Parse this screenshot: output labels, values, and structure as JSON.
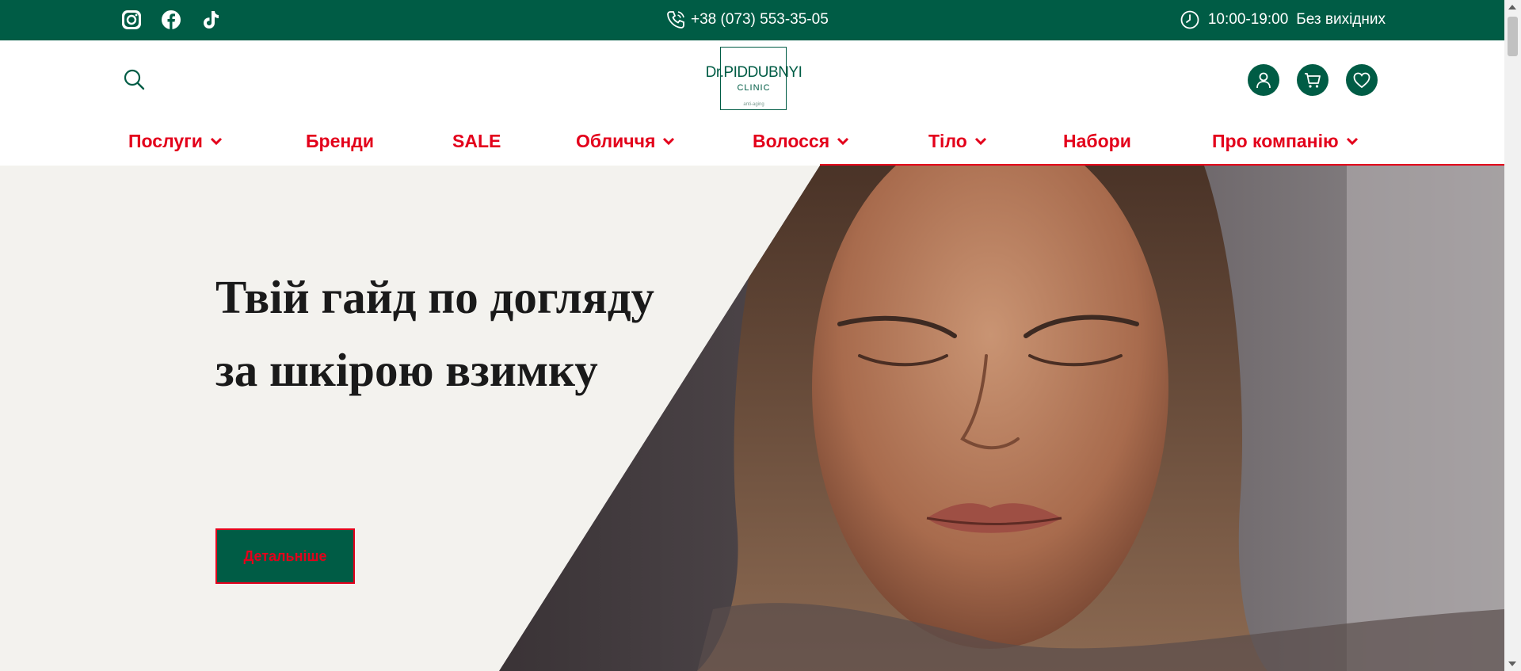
{
  "topbar": {
    "social_icons": [
      "instagram-icon",
      "facebook-icon",
      "tiktok-icon"
    ],
    "phone": "+38 (073) 553-35-05",
    "hours": "10:00-19:00",
    "days": "Без вихідних"
  },
  "header": {
    "logo": {
      "name": "Dr.PIDDUBNYI",
      "sub": "CLINIC",
      "tagline": "anti-aging"
    },
    "icons": [
      "search-icon",
      "user-icon",
      "cart-icon",
      "heart-icon"
    ]
  },
  "nav": {
    "items": [
      {
        "label": "Послуги",
        "has_dropdown": true
      },
      {
        "label": "Бренди",
        "has_dropdown": false
      },
      {
        "label": "SALE",
        "has_dropdown": false
      },
      {
        "label": "Обличчя",
        "has_dropdown": true
      },
      {
        "label": "Волосся",
        "has_dropdown": true
      },
      {
        "label": "Тіло",
        "has_dropdown": true
      },
      {
        "label": "Набори",
        "has_dropdown": false
      },
      {
        "label": "Про компанію",
        "has_dropdown": true
      }
    ]
  },
  "hero": {
    "title": "Твій гайд по догляду за шкірою взимку",
    "button": "Детальніше"
  },
  "colors": {
    "brand": "#005c45",
    "accent": "#e3001b",
    "hero_bg": "#f3f2ee"
  }
}
